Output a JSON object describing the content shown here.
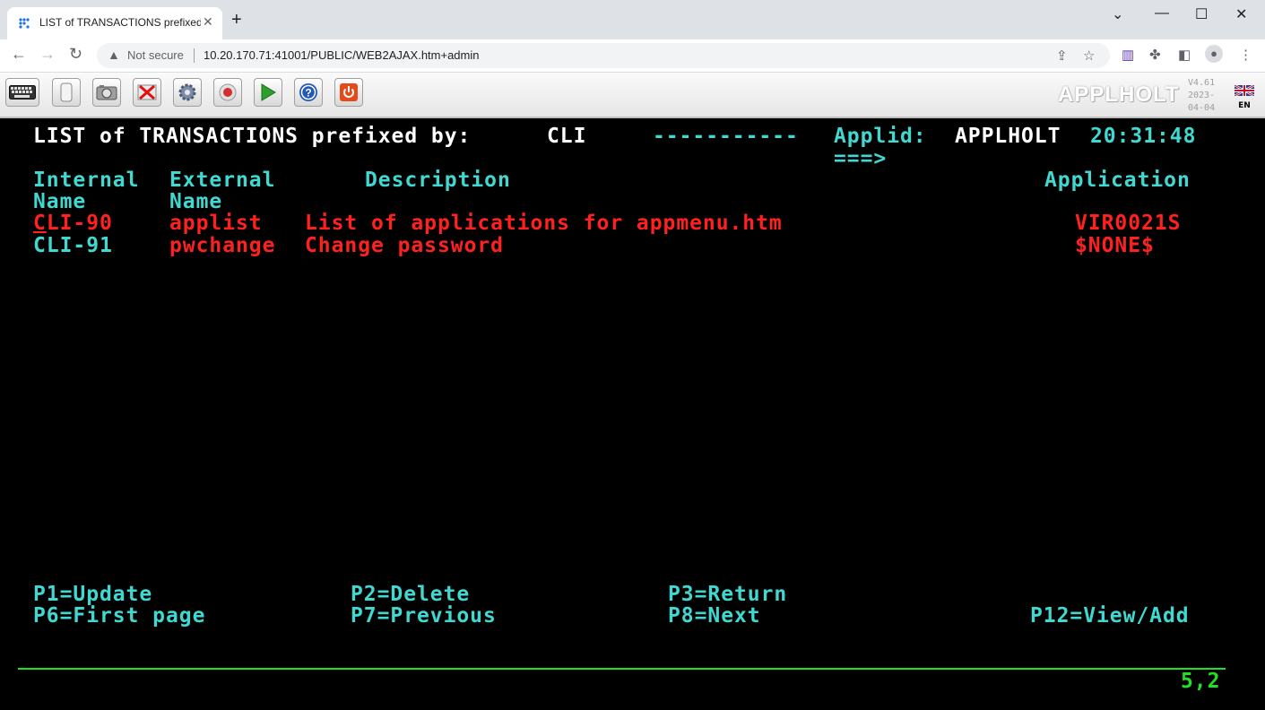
{
  "browser": {
    "tab_title": "LIST of TRANSACTIONS prefixed",
    "not_secure": "Not secure",
    "url": "10.20.170.71:41001/PUBLIC/WEB2AJAX.htm+admin"
  },
  "toolbar": {
    "brand": "APPLHOLT",
    "version": "V4.61",
    "date_line1": "2023-",
    "date_line2": "04-04",
    "lang": "EN"
  },
  "screen": {
    "title": "LIST of TRANSACTIONS prefixed by:",
    "prefix": "CLI",
    "dashes": "-----------",
    "applid_label": "Applid:",
    "applid": "APPLHOLT",
    "time": "20:31:48",
    "command_arrow": "===>",
    "headers": {
      "internal": "Internal",
      "internal2": "Name",
      "external": "External",
      "external2": "Name",
      "description": "Description",
      "application": "Application"
    },
    "rows": [
      {
        "internal_first": "C",
        "internal_rest": "LI-90",
        "external": "applist",
        "description": "List of applications for appmenu.htm",
        "application": "VIR0021S"
      },
      {
        "internal_first": "C",
        "internal_rest": "LI-91",
        "external": "pwchange",
        "description": "Change password",
        "application": "$NONE$"
      }
    ],
    "pfkeys": {
      "p1": "P1=Update",
      "p2": "P2=Delete",
      "p3": "P3=Return",
      "p6": "P6=First page",
      "p7": "P7=Previous",
      "p8": "P8=Next",
      "p12": "P12=View/Add"
    },
    "cursor_pos": "5,2"
  },
  "colors": {
    "protected_white": "#ffffff",
    "turquoise": "#40d8d0",
    "red": "#ff2020",
    "green": "#20e020"
  }
}
